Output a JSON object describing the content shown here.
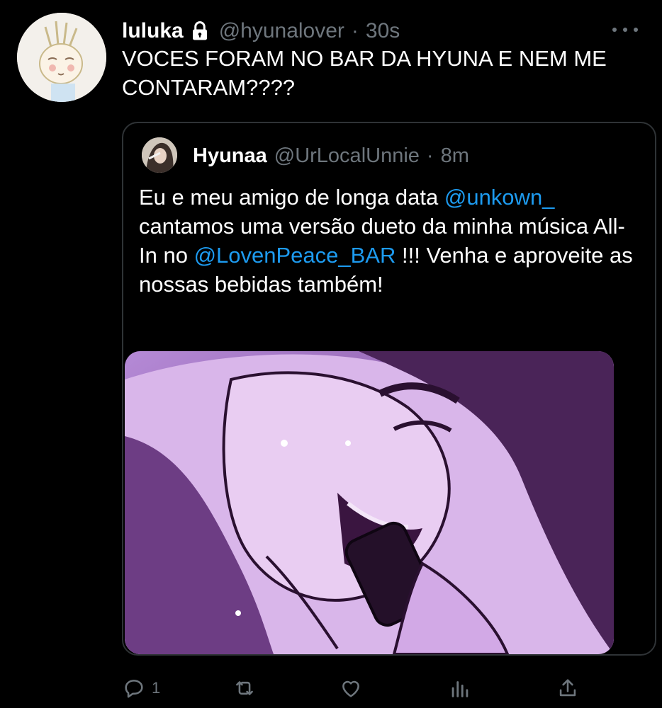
{
  "tweet": {
    "display_name": "luluka",
    "handle": "@hyunalover",
    "separator": "·",
    "time": "30s",
    "text": "VOCES FORAM NO BAR DA HYUNA E NEM ME CONTARAM????",
    "protected_icon": "lock-icon",
    "more_icon": "more-horizontal-icon"
  },
  "quote": {
    "display_name": "Hyunaa",
    "handle": "@UrLocalUnnie",
    "separator": "·",
    "time": "8m",
    "text_part1": "Eu e meu amigo de longa data ",
    "mention1": "@unkown_",
    "text_part2": " cantamos uma versão dueto da minha música All-In no ",
    "mention2": "@LovenPeace_BAR",
    "text_part3": " !!! Venha e aproveite as nossas bebidas também!"
  },
  "actions": {
    "reply_count": "1",
    "reply_icon": "reply-icon",
    "retweet_icon": "retweet-icon",
    "like_icon": "heart-icon",
    "stats_icon": "bar-chart-icon",
    "share_icon": "share-icon"
  },
  "colors": {
    "background": "#000000",
    "text": "#ffffff",
    "secondary_text": "#6e767d",
    "link": "#1d9bf0",
    "border": "#2f3336"
  }
}
